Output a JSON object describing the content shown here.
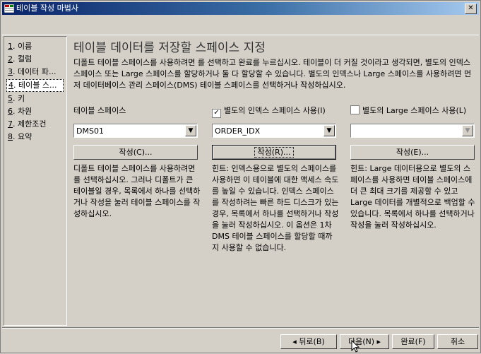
{
  "window": {
    "title": "테이블 작성 마법사",
    "close_label": "✕"
  },
  "sidebar": {
    "items": [
      {
        "num": "1",
        "label": ". 이름"
      },
      {
        "num": "2",
        "label": ". 컬럼"
      },
      {
        "num": "3",
        "label": ". 데이터 파..."
      },
      {
        "num": "4",
        "label": ". 테이블 스..."
      },
      {
        "num": "5",
        "label": ". 키"
      },
      {
        "num": "6",
        "label": ". 차원"
      },
      {
        "num": "7",
        "label": ". 제한조건"
      },
      {
        "num": "8",
        "label": ". 요약"
      }
    ],
    "active_index": 3
  },
  "main": {
    "title": "테이블 데이터를 저장할 스페이스 지정",
    "description": "디폴트 테이블 스페이스를 사용하려면 를 선택하고 완료를 누르십시오. 테이블이 더 커질 것이라고 생각되면, 별도의 인덱스 스페이스 또는 Large 스페이스를 할당하거나 둘 다 할당할 수 있습니다. 별도의 인덱스나 Large 스페이스를 사용하려면 먼저 데이터베이스 관리 스페이스(DMS) 테이블 스페이스를 선택하거나 작성하십시오.",
    "columns": [
      {
        "heading": "테이블 스페이스",
        "checkbox": false,
        "combo_value": "DMS01",
        "create_label": "작성(C)...",
        "hint": "디폴트 테이블 스페이스를 사용하려면 를 선택하십시오. 그러나 디폴트가 큰 테이블일 경우, 목록에서 하나를 선택하거나 작성을 눌러 테이블 스페이스를 작성하십시오."
      },
      {
        "heading": "별도의 인덱스 스페이스 사용(I)",
        "checkbox": true,
        "checked": true,
        "combo_value": "ORDER_IDX",
        "create_label": "작성(R)...",
        "hint": "힌트: 인덱스용으로 별도의 스페이스를 사용하면 이 테이블에 대한 액세스 속도를 높일 수 있습니다. 인덱스 스페이스를 작성하려는 빠른 하드 디스크가 있는 경우, 목록에서 하나를 선택하거나 작성을 눌러 작성하십시오. 이 옵션은 1차 DMS 테이블 스페이스를 할당할 때까지 사용할 수 없습니다."
      },
      {
        "heading": "별도의 Large 스페이스 사용(L)",
        "checkbox": true,
        "checked": false,
        "combo_value": "",
        "create_label": "작성(E)...",
        "hint": "힌트: Large 데이터용으로 별도의 스페이스를 사용하면 테이블 스페이스에 더 큰 최대 크기를 제공할 수 있고 Large 데이터를 개별적으로 백업할 수 있습니다. 목록에서 하나를 선택하거나 작성을 눌러 작성하십시오."
      }
    ]
  },
  "footer": {
    "back_label": "◂ 뒤로(B)",
    "next_label": "다음(N) ▸",
    "finish_label": "완료(F)",
    "cancel_label": "취소"
  },
  "colors": {
    "titlebar_start": "#0a246a",
    "titlebar_end": "#a6caf0",
    "face": "#d4d0c8"
  }
}
